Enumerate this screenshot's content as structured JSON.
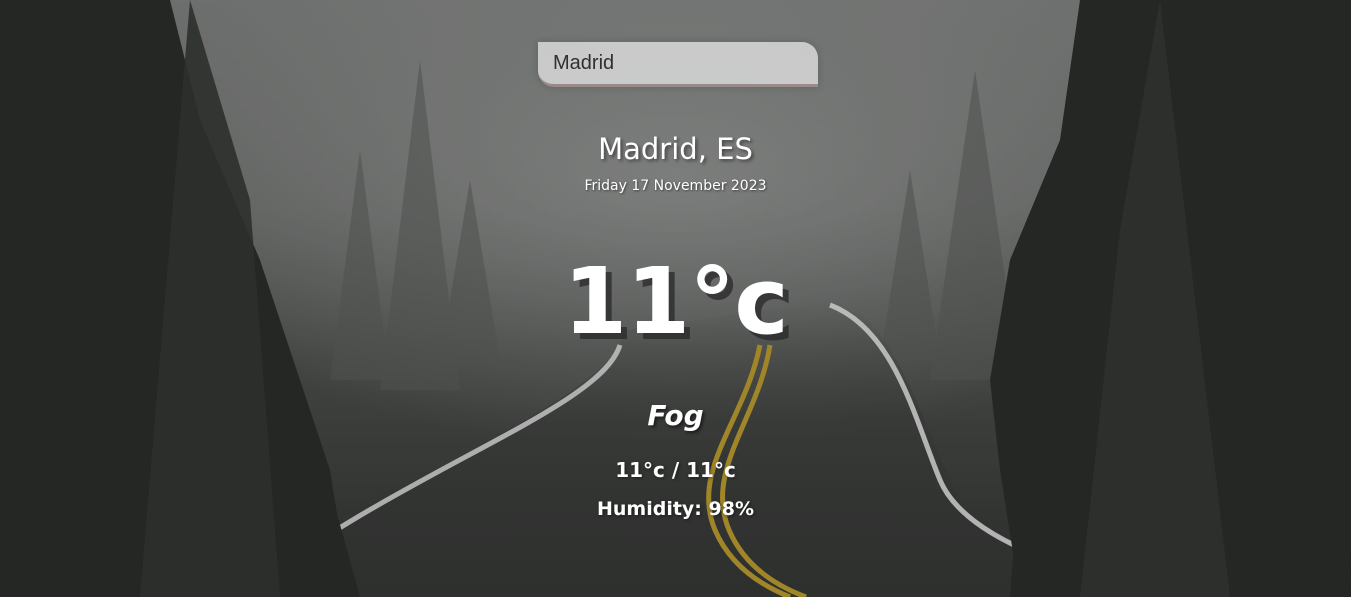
{
  "search": {
    "value": "Madrid"
  },
  "location": {
    "city_country": "Madrid, ES",
    "date": "Friday 17 November 2023"
  },
  "weather": {
    "temperature": "11°c",
    "condition": "Fog",
    "hi_low": "11°c / 11°c",
    "humidity": "Humidity: 98%"
  },
  "background": {
    "scene": "foggy-forest-road",
    "fog_color": "#7a7a7a",
    "tree_color": "#1c1e1b",
    "road_line_color": "#b59324",
    "road_edge_color": "#d8d8d8"
  }
}
